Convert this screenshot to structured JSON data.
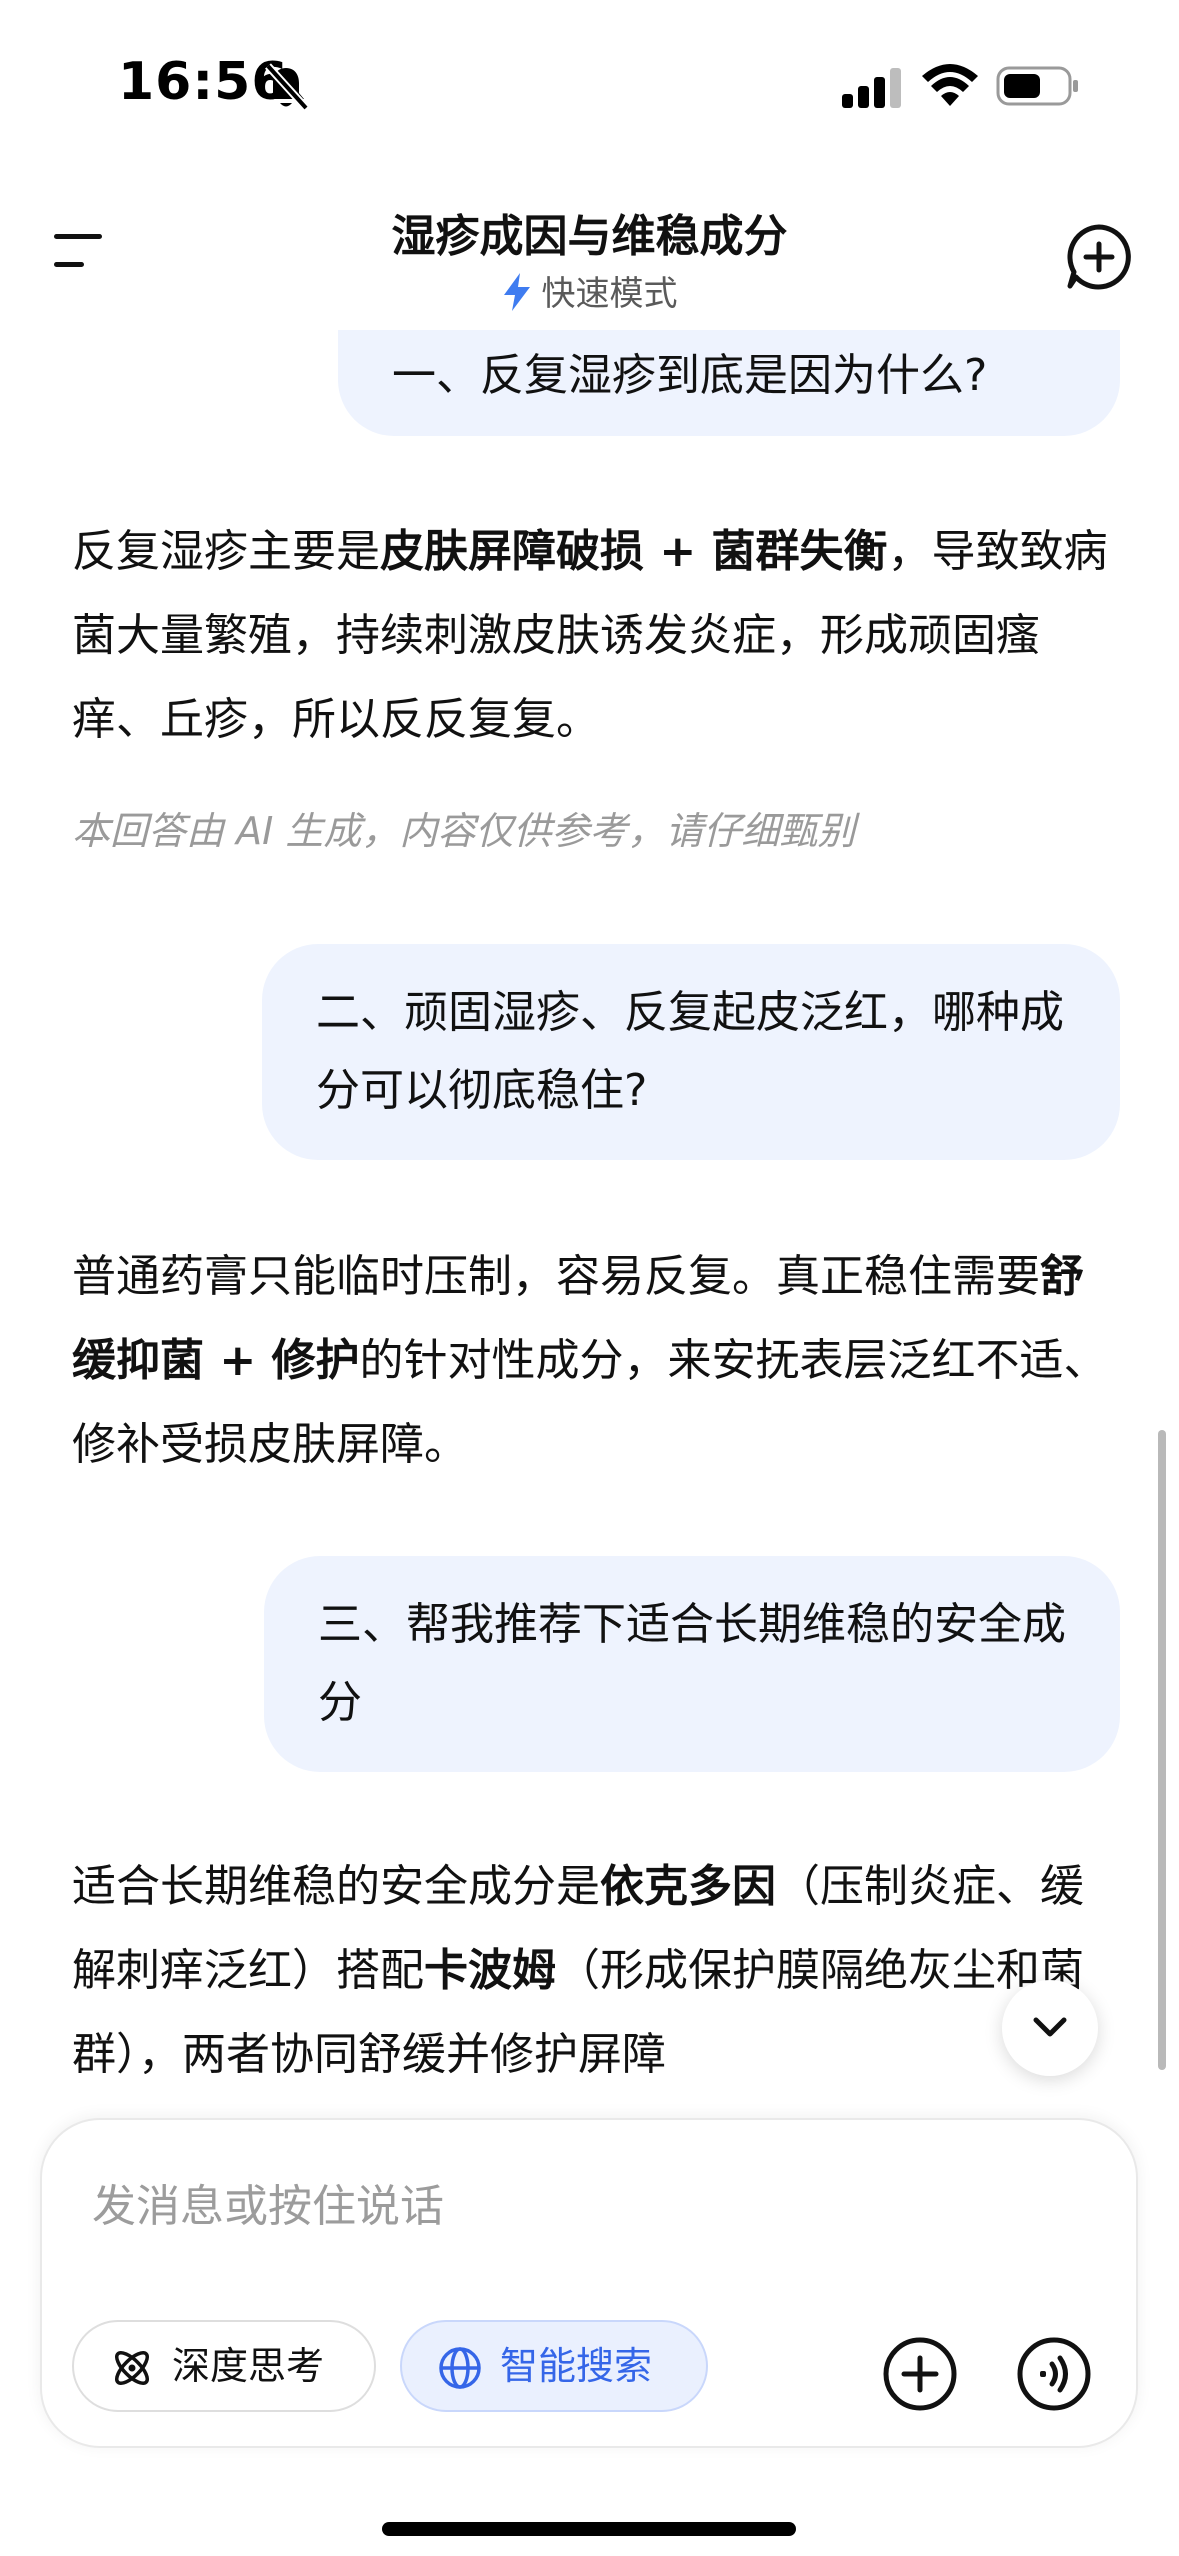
{
  "status_bar": {
    "time": "16:56"
  },
  "header": {
    "title": "湿疹成因与维稳成分",
    "mode": "快速模式"
  },
  "messages": [
    {
      "role": "user",
      "text": "一、反复湿疹到底是因为什么?"
    },
    {
      "role": "assistant",
      "segments": [
        {
          "text": "反复湿疹主要是",
          "bold": false
        },
        {
          "text": "皮肤屏障破损 + 菌群失衡",
          "bold": true
        },
        {
          "text": "，导致致病菌大量繁殖，持续刺激皮肤诱发炎症，形成顽固瘙痒、丘疹，所以反反复复。",
          "bold": false
        }
      ]
    },
    {
      "role": "disclaimer",
      "text": "本回答由 AI 生成，内容仅供参考，请仔细甄别"
    },
    {
      "role": "user",
      "text": "二、顽固湿疹、反复起皮泛红，哪种成分可以彻底稳住?"
    },
    {
      "role": "assistant",
      "segments": [
        {
          "text": "普通药膏只能临时压制，容易反复。真正稳住需要",
          "bold": false
        },
        {
          "text": "舒缓抑菌 + 修护",
          "bold": true
        },
        {
          "text": "的针对性成分，来安抚表层泛红不适、修补受损皮肤屏障。",
          "bold": false
        }
      ]
    },
    {
      "role": "user",
      "text": "三、帮我推荐下适合长期维稳的安全成分"
    },
    {
      "role": "assistant",
      "segments": [
        {
          "text": "适合长期维稳的安全成分是",
          "bold": false
        },
        {
          "text": "依克多因",
          "bold": true
        },
        {
          "text": "（压制炎症、缓解刺痒泛红）搭配",
          "bold": false
        },
        {
          "text": "卡波姆",
          "bold": true
        },
        {
          "text": "（形成保护膜隔绝灰尘和菌群），两者协同舒缓并修护屏障",
          "bold": false
        }
      ]
    }
  ],
  "composer": {
    "placeholder": "发消息或按住说话",
    "deep_think_label": "深度思考",
    "smart_search_label": "智能搜索"
  },
  "colors": {
    "accent": "#3566e8",
    "bubble": "#eef3fe"
  }
}
